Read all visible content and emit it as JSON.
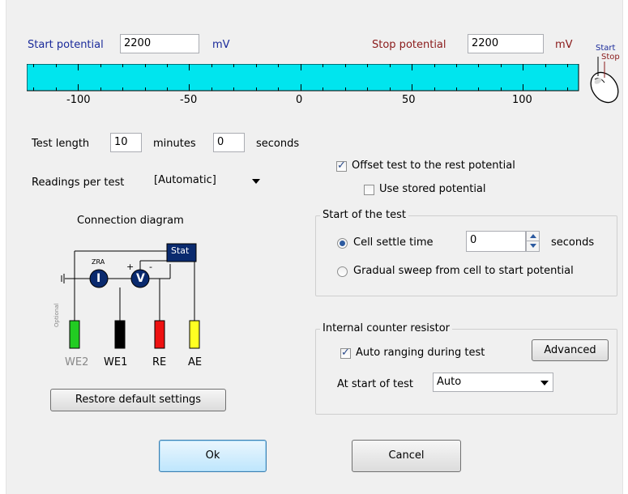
{
  "potential": {
    "start_label": "Start potential",
    "start_value": "2200",
    "start_unit": "mV",
    "stop_label": "Stop potential",
    "stop_value": "2200",
    "stop_unit": "mV",
    "scale_labels": [
      "-100",
      "-50",
      "0",
      "50",
      "100"
    ],
    "scale_color": "#00e5ee",
    "mouse_start": "Start",
    "mouse_stop": "Stop"
  },
  "test_length": {
    "label": "Test length",
    "minutes_value": "10",
    "minutes_label": "minutes",
    "seconds_value": "0",
    "seconds_label": "seconds"
  },
  "readings": {
    "label": "Readings per test",
    "selected": "[Automatic]"
  },
  "offset": {
    "offset_label": "Offset test to the rest potential",
    "offset_checked": true,
    "stored_label": "Use stored potential",
    "stored_checked": false
  },
  "start_group": {
    "title": "Start of the test",
    "settle_label": "Cell settle time",
    "settle_value": "0",
    "settle_unit": "seconds",
    "sweep_label": "Gradual sweep from cell to start potential",
    "selected": "settle"
  },
  "diagram": {
    "title": "Connection diagram",
    "stat_label": "Stat",
    "zra_label": "ZRA",
    "i_label": "I",
    "v_label": "V",
    "optional_label": "Optional",
    "electrodes": [
      {
        "label": "WE2",
        "color": "#22cc22",
        "dim": true
      },
      {
        "label": "WE1",
        "color": "#000000",
        "dim": false
      },
      {
        "label": "RE",
        "color": "#ee1111",
        "dim": false
      },
      {
        "label": "AE",
        "color": "#ffff22",
        "dim": false
      }
    ]
  },
  "restore_label": "Restore default settings",
  "resistor_group": {
    "title": "Internal counter resistor",
    "auto_label": "Auto ranging during test",
    "auto_checked": true,
    "advanced_label": "Advanced",
    "start_label": "At start of test",
    "start_value": "Auto"
  },
  "ok_label": "Ok",
  "cancel_label": "Cancel"
}
